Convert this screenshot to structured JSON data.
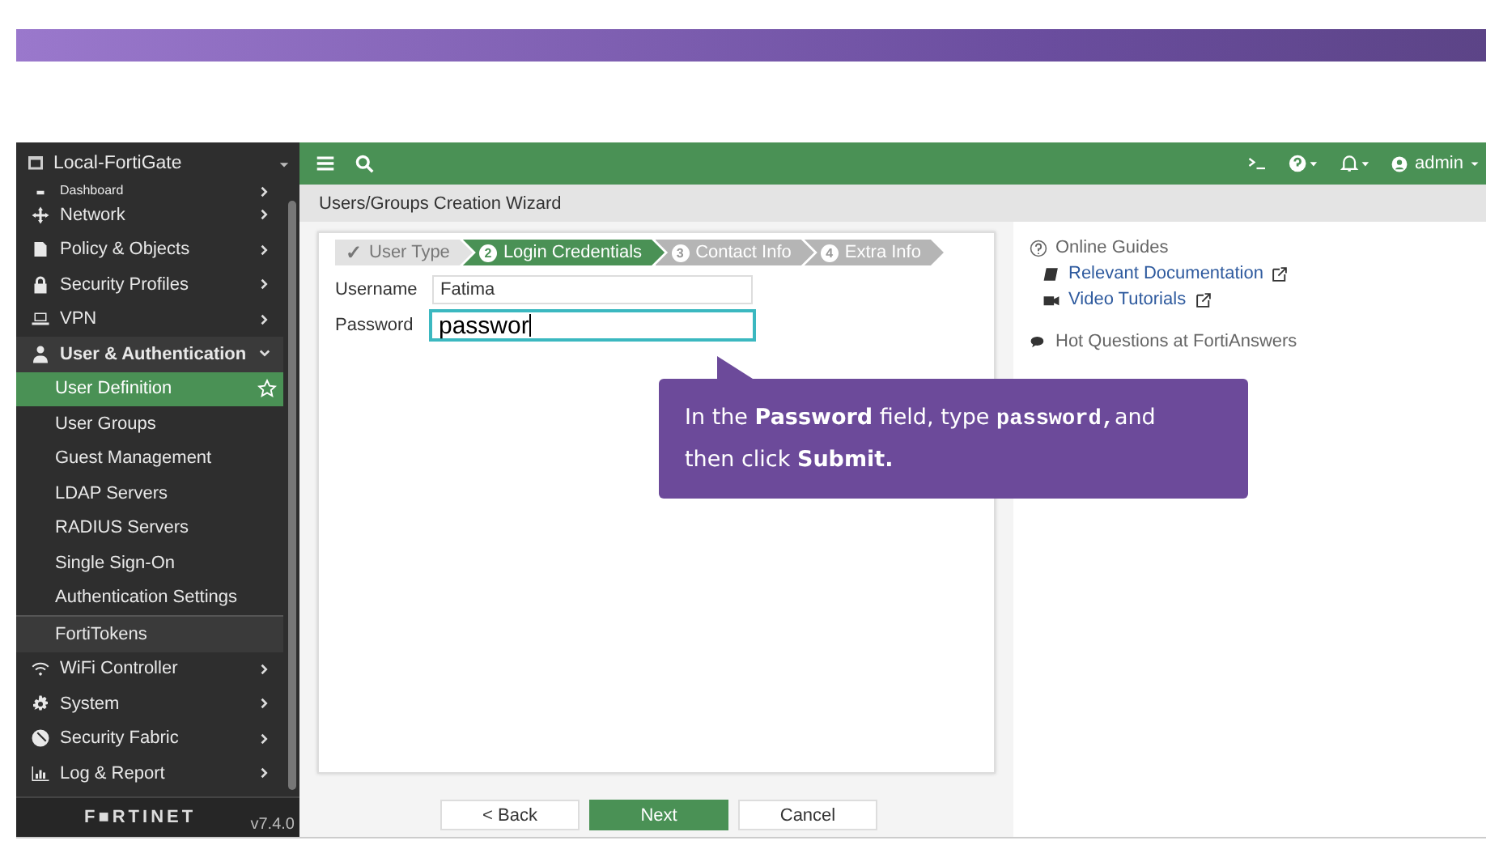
{
  "device": {
    "name": "Local-FortiGate"
  },
  "sidebar": {
    "items": [
      {
        "label": "Dashboard",
        "expanded": false
      },
      {
        "label": "Network",
        "expanded": false
      },
      {
        "label": "Policy & Objects",
        "expanded": false
      },
      {
        "label": "Security Profiles",
        "expanded": false
      },
      {
        "label": "VPN",
        "expanded": false
      },
      {
        "label": "User & Authentication",
        "expanded": true,
        "children": [
          {
            "label": "User Definition",
            "selected": true
          },
          {
            "label": "User Groups",
            "selected": false
          },
          {
            "label": "Guest Management",
            "selected": false
          },
          {
            "label": "LDAP Servers",
            "selected": false
          },
          {
            "label": "RADIUS Servers",
            "selected": false
          },
          {
            "label": "Single Sign-On",
            "selected": false
          },
          {
            "label": "Authentication Settings",
            "selected": false
          },
          {
            "label": "FortiTokens",
            "selected": false
          }
        ]
      },
      {
        "label": "WiFi Controller",
        "expanded": false
      },
      {
        "label": "System",
        "expanded": false
      },
      {
        "label": "Security Fabric",
        "expanded": false
      },
      {
        "label": "Log & Report",
        "expanded": false
      }
    ],
    "brand": "F■RTINET",
    "version": "v7.4.0"
  },
  "topbar": {
    "user": "admin"
  },
  "breadcrumb": "Users/Groups Creation Wizard",
  "steps": [
    {
      "kind": "done",
      "mark": "✓",
      "label": "User Type"
    },
    {
      "kind": "active",
      "mark": "2",
      "label": "Login Credentials"
    },
    {
      "kind": "pending",
      "mark": "3",
      "label": "Contact Info"
    },
    {
      "kind": "pending",
      "mark": "4",
      "label": "Extra Info"
    }
  ],
  "form": {
    "fields": [
      {
        "label": "Username",
        "value": "Fatima",
        "focused": false
      },
      {
        "label": "Password",
        "value": "passwor",
        "focused": true
      }
    ]
  },
  "guides": {
    "title": "Online Guides",
    "links": [
      "Relevant Documentation",
      "Video Tutorials"
    ],
    "hot_title": "Hot Questions at FortiAnswers"
  },
  "tooltip": {
    "parts": [
      {
        "kind": "text",
        "text": "In the "
      },
      {
        "kind": "bold",
        "text": "Password"
      },
      {
        "kind": "text",
        "text": " field, type "
      },
      {
        "kind": "code",
        "text": "password,"
      },
      {
        "kind": "text",
        "text": "and then click "
      },
      {
        "kind": "bold",
        "text": "Submit."
      }
    ]
  },
  "buttons": [
    {
      "label": "< Back",
      "kind": "plain"
    },
    {
      "label": "Next",
      "kind": "primary"
    },
    {
      "label": "Cancel",
      "kind": "plain"
    }
  ]
}
